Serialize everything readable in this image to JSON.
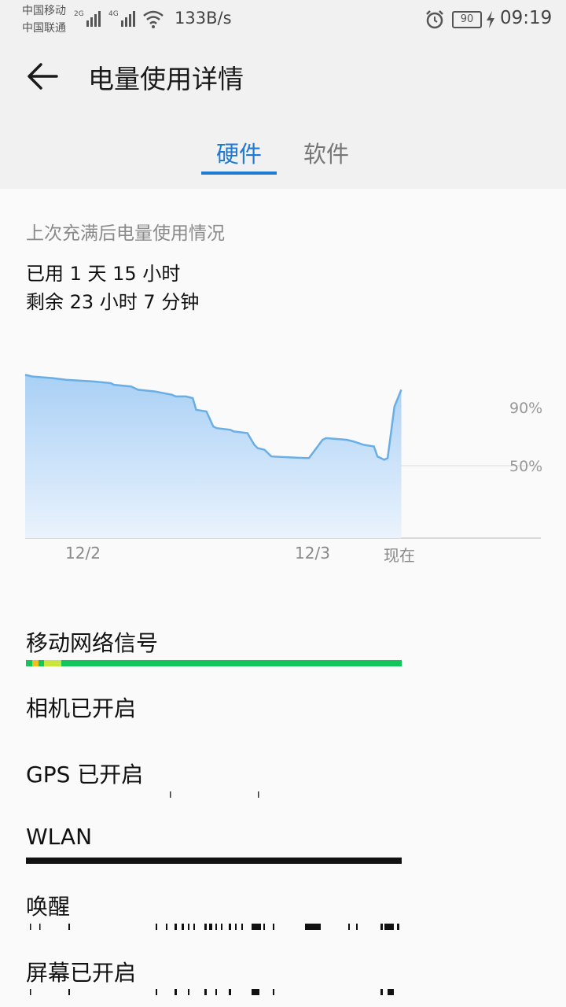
{
  "status_bar": {
    "carrier1": "中国移动",
    "carrier2": "中国联通",
    "net_speed": "133B/s",
    "battery": "90",
    "time": "09:19",
    "icons": [
      "signal-2g-icon",
      "signal-4g-icon",
      "wifi-icon",
      "alarm-icon",
      "charging-icon"
    ]
  },
  "header": {
    "title": "电量使用详情",
    "back_icon": "back-arrow-icon"
  },
  "tabs": [
    {
      "label": "硬件",
      "active": true
    },
    {
      "label": "软件",
      "active": false
    }
  ],
  "summary": {
    "subtitle": "上次充满后电量使用情况",
    "used": "已用 1 天 15 小时",
    "remaining": "剩余 23 小时 7 分钟"
  },
  "chart_data": {
    "type": "area",
    "x_ticks": [
      "12/2",
      "12/3",
      "现在"
    ],
    "y_ticks": [
      "90%",
      "50%"
    ],
    "ylim": [
      0,
      100
    ],
    "colors": {
      "line": "#6aaee6",
      "fill_top": "#a9d0f5",
      "fill_bottom": "#eaf3fd"
    },
    "points": [
      [
        0,
        98
      ],
      [
        0.02,
        97
      ],
      [
        0.08,
        96
      ],
      [
        0.12,
        95
      ],
      [
        0.2,
        94
      ],
      [
        0.25,
        93
      ],
      [
        0.26,
        92
      ],
      [
        0.31,
        91
      ],
      [
        0.33,
        89
      ],
      [
        0.38,
        88
      ],
      [
        0.43,
        86
      ],
      [
        0.44,
        85
      ],
      [
        0.47,
        85
      ],
      [
        0.49,
        84
      ],
      [
        0.5,
        77
      ],
      [
        0.53,
        76
      ],
      [
        0.55,
        67
      ],
      [
        0.56,
        66
      ],
      [
        0.6,
        65
      ],
      [
        0.61,
        64
      ],
      [
        0.65,
        63
      ],
      [
        0.67,
        56
      ],
      [
        0.68,
        54
      ],
      [
        0.7,
        53
      ],
      [
        0.72,
        49
      ],
      [
        0.82,
        48
      ],
      [
        0.83,
        48
      ],
      [
        0.87,
        59
      ],
      [
        0.88,
        60
      ],
      [
        0.94,
        59
      ],
      [
        0.96,
        58
      ],
      [
        0.99,
        56
      ],
      [
        1.02,
        55
      ],
      [
        1.03,
        49
      ],
      [
        1.05,
        47
      ],
      [
        1.06,
        48
      ],
      [
        1.08,
        79
      ],
      [
        1.1,
        89
      ]
    ]
  },
  "items": [
    {
      "label": "移动网络信号"
    },
    {
      "label": "相机已开启"
    },
    {
      "label": "GPS 已开启"
    },
    {
      "label": "WLAN"
    },
    {
      "label": "唤醒"
    },
    {
      "label": "屏幕已开启"
    }
  ],
  "bar_colors": {
    "signal_good": "#12c65a",
    "signal_fair": "#c8e63c",
    "signal_weak": "#f0c020",
    "on": "#111111"
  }
}
